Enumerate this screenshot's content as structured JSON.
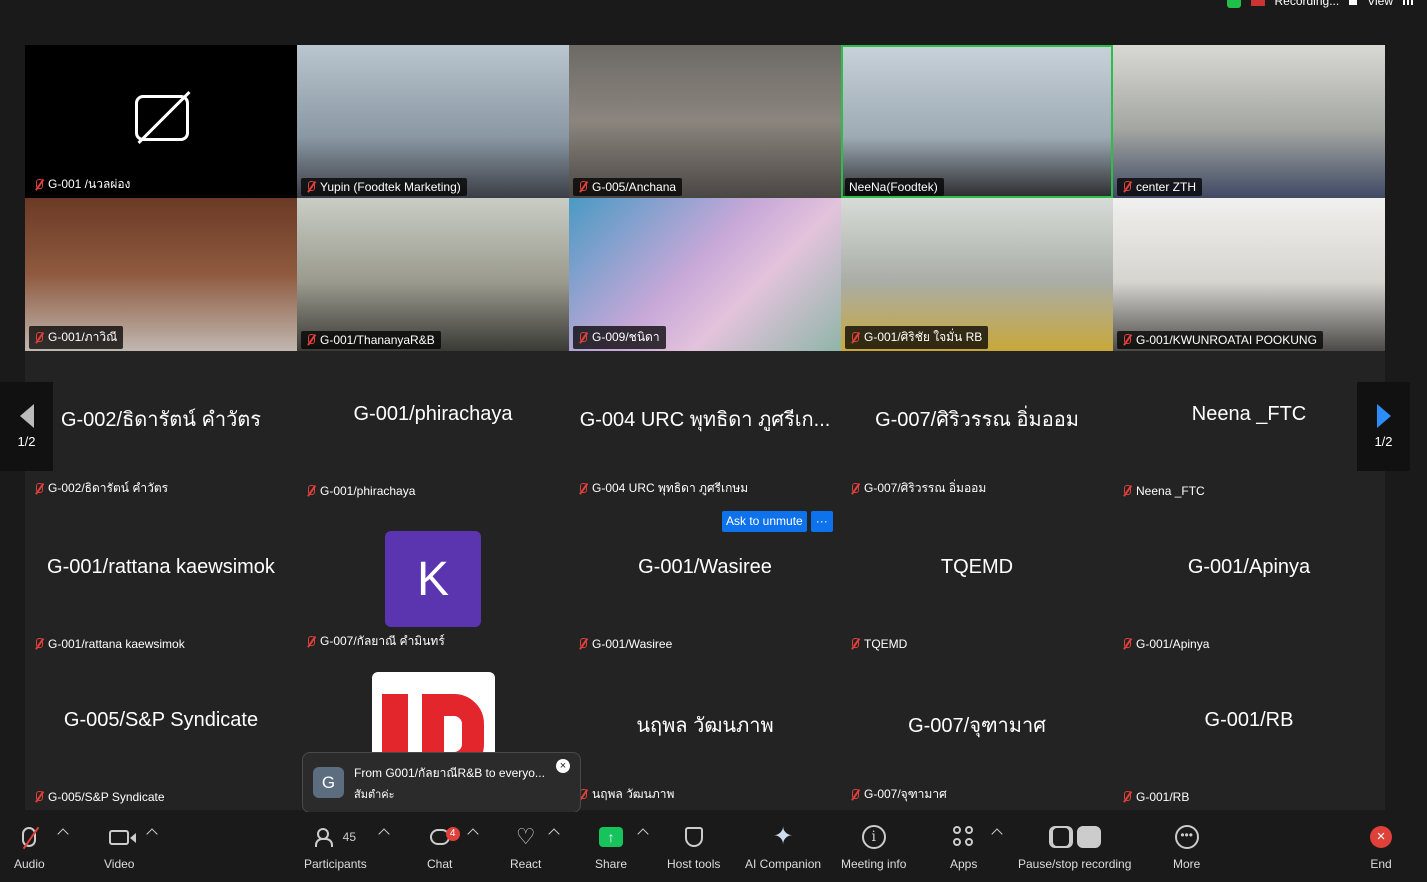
{
  "status": {
    "recording_label": "Recording...",
    "view_label": "View"
  },
  "video_tiles": [
    {
      "name": "G-001 /นวลผ่อง",
      "camera_off": true
    },
    {
      "name": "Yupin (Foodtek Marketing)"
    },
    {
      "name": "G-005/Anchana"
    },
    {
      "name": "NeeNa(Foodtek)",
      "active_speaker": true
    },
    {
      "name": "center ZTH"
    },
    {
      "name": "G-001/ภาวิณี"
    },
    {
      "name": "G-001/ThananyaR&B"
    },
    {
      "name": "G-009/ชนิดา"
    },
    {
      "name": "G-001/ศิริชัย ใจมั่น RB"
    },
    {
      "name": "G-001/KWUNROATAI POOKUNG"
    }
  ],
  "name_tiles": [
    {
      "display": "G-002/ธิดารัตน์ คำวัตร",
      "tag": "G-002/ธิดารัตน์ คำวัตร"
    },
    {
      "display": "G-001/phirachaya",
      "tag": "G-001/phirachaya"
    },
    {
      "display": "G-004 URC พุทธิดา ภูศรีเก...",
      "tag": "G-004 URC พุทธิดา ภูศรีเกษม"
    },
    {
      "display": "G-007/ศิริวรรณ อิ่มออม",
      "tag": "G-007/ศิริวรรณ อิ่มออม"
    },
    {
      "display": "Neena _FTC",
      "tag": "Neena _FTC"
    },
    {
      "display": "G-001/rattana kaewsimok",
      "tag": "G-001/rattana kaewsimok"
    },
    {
      "display": "",
      "tag": "G-007/กัลยาณี คำมินทร์",
      "avatar_letter": "K",
      "avatar_color": "#5b35b0"
    },
    {
      "display": "G-001/Wasiree",
      "tag": "G-001/Wasiree"
    },
    {
      "display": "TQEMD",
      "tag": "TQEMD"
    },
    {
      "display": "G-001/Apinya",
      "tag": "G-001/Apinya"
    },
    {
      "display": "G-005/S&P Syndicate",
      "tag": "G-005/S&P Syndicate"
    },
    {
      "display": "",
      "tag": "",
      "avatar_logo": "LR"
    },
    {
      "display": "นฤพล วัฒนภาพ",
      "tag": "นฤพล วัฒนภาพ"
    },
    {
      "display": "G-007/จุฑามาศ",
      "tag": "G-007/จุฑามาศ"
    },
    {
      "display": "G-001/RB",
      "tag": "G-001/RB"
    }
  ],
  "pager": {
    "left": "1/2",
    "right": "1/2"
  },
  "unmute": {
    "label": "Ask to unmute",
    "more": "···"
  },
  "toast": {
    "avatar_letter": "G",
    "from": "From G001/กัลยาณีR&B to everyo...",
    "message": "สัมตำค่ะ",
    "close": "×"
  },
  "toolbar": {
    "audio": "Audio",
    "video": "Video",
    "participants": "Participants",
    "participants_count": "45",
    "chat": "Chat",
    "chat_badge": "4",
    "react": "React",
    "share": "Share",
    "host_tools": "Host tools",
    "ai_companion": "AI Companion",
    "meeting_info": "Meeting info",
    "apps": "Apps",
    "recording": "Pause/stop recording",
    "more": "More",
    "end": "End"
  },
  "colors": {
    "accent": "#0e72ed",
    "active_speaker": "#2dbe4a",
    "share": "#17c45c",
    "end": "#e0403a"
  }
}
